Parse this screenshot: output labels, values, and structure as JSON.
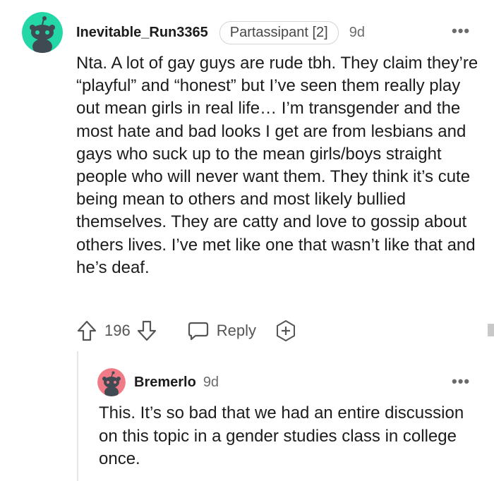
{
  "comment": {
    "username": "Inevitable_Run3365",
    "flair": "Partassipant [2]",
    "timestamp": "9d",
    "more_label": "•••",
    "body": "Nta. A lot of gay guys are rude tbh. They claim they’re “playful” and “honest” but I’ve seen them really play out mean girls in real life… I’m transgender and the most hate and bad looks I get are from lesbians and gays who suck up to the mean girls/boys straight people who will never want them. They think it’s cute being mean to others and most likely bullied themselves. They are catty and love to gossip about others lives. I’ve met like one that wasn’t like that and he’s deaf.",
    "vote_count": "196",
    "reply_label": "Reply",
    "icons": {
      "avatar": "snoo-avatar-icon",
      "upvote": "upvote-arrow-icon",
      "downvote": "downvote-arrow-icon",
      "reply": "speech-bubble-icon",
      "award": "add-award-icon"
    },
    "avatar_color": "#24d7a6"
  },
  "reply": {
    "username": "Bremerlo",
    "timestamp": "9d",
    "more_label": "•••",
    "body": "This. It’s so bad that we had an entire discussion on this topic in a gender studies class in college once.",
    "avatar_color": "#f07b86"
  }
}
